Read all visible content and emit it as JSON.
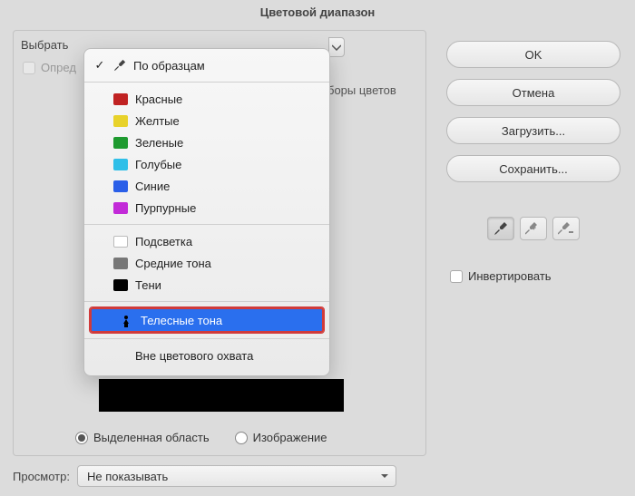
{
  "title": "Цветовой диапазон",
  "selectLabel": "Выбрать",
  "detectLabel": "Опред",
  "partialRight": "боры цветов",
  "dropdown": {
    "header": {
      "label": "По образцам",
      "checked": true
    },
    "colors": [
      {
        "label": "Красные",
        "swatch": "red"
      },
      {
        "label": "Желтые",
        "swatch": "yellow"
      },
      {
        "label": "Зеленые",
        "swatch": "green"
      },
      {
        "label": "Голубые",
        "swatch": "cyan"
      },
      {
        "label": "Синие",
        "swatch": "blue"
      },
      {
        "label": "Пурпурные",
        "swatch": "magenta"
      }
    ],
    "tones": [
      {
        "label": "Подсветка",
        "swatch": "light"
      },
      {
        "label": "Средние тона",
        "swatch": "mid"
      },
      {
        "label": "Тени",
        "swatch": "dark"
      }
    ],
    "skin": {
      "label": "Телесные тона"
    },
    "gamut": {
      "label": "Вне цветового охвата"
    }
  },
  "radios": {
    "selection": "Выделенная область",
    "image": "Изображение",
    "checked": "selection"
  },
  "buttons": {
    "ok": "OK",
    "cancel": "Отмена",
    "load": "Загрузить...",
    "save": "Сохранить..."
  },
  "invertLabel": "Инвертировать",
  "previewLabel": "Просмотр:",
  "previewSelect": "Не показывать"
}
